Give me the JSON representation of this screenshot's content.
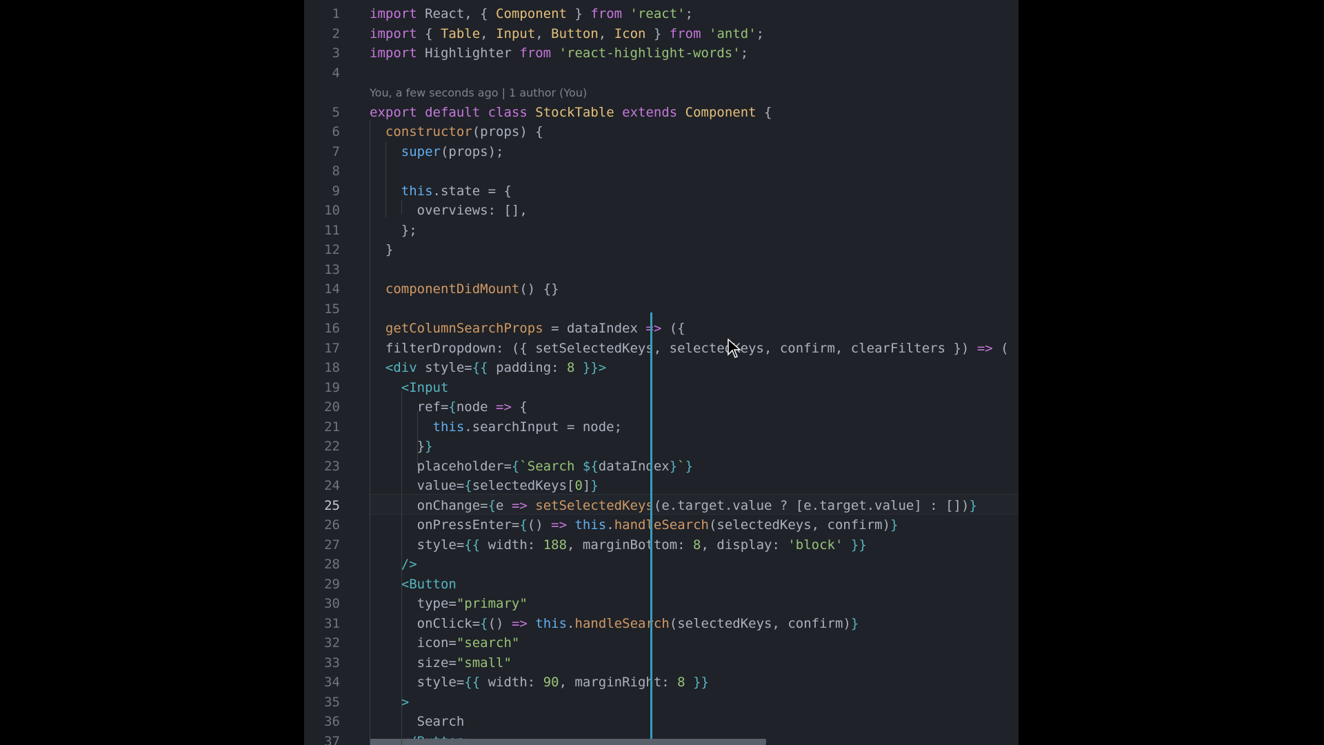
{
  "editor": {
    "codelens": "You, a few seconds ago | 1 author (You)",
    "active_line": "25",
    "lines": [
      {
        "n": "1",
        "tokens": [
          [
            "kw",
            "import"
          ],
          [
            "txt",
            " React, { "
          ],
          [
            "cls",
            "Component"
          ],
          [
            "txt",
            " } "
          ],
          [
            "kw",
            "from"
          ],
          [
            "txt",
            " "
          ],
          [
            "str",
            "'react'"
          ],
          [
            "txt",
            ";"
          ]
        ]
      },
      {
        "n": "2",
        "tokens": [
          [
            "kw",
            "import"
          ],
          [
            "txt",
            " { "
          ],
          [
            "cls",
            "Table"
          ],
          [
            "txt",
            ", "
          ],
          [
            "cls",
            "Input"
          ],
          [
            "txt",
            ", "
          ],
          [
            "cls",
            "Button"
          ],
          [
            "txt",
            ", "
          ],
          [
            "cls",
            "Icon"
          ],
          [
            "txt",
            " } "
          ],
          [
            "kw",
            "from"
          ],
          [
            "txt",
            " "
          ],
          [
            "str",
            "'antd'"
          ],
          [
            "txt",
            ";"
          ]
        ]
      },
      {
        "n": "3",
        "tokens": [
          [
            "kw",
            "import"
          ],
          [
            "txt",
            " Highlighter "
          ],
          [
            "kw",
            "from"
          ],
          [
            "txt",
            " "
          ],
          [
            "str",
            "'react-highlight-words'"
          ],
          [
            "txt",
            ";"
          ]
        ]
      },
      {
        "n": "4",
        "tokens": []
      },
      {
        "n": "5",
        "tokens": [
          [
            "kw",
            "export"
          ],
          [
            "txt",
            " "
          ],
          [
            "kw",
            "default"
          ],
          [
            "txt",
            " "
          ],
          [
            "kw",
            "class"
          ],
          [
            "txt",
            " "
          ],
          [
            "cls",
            "StockTable"
          ],
          [
            "txt",
            " "
          ],
          [
            "kw",
            "extends"
          ],
          [
            "txt",
            " "
          ],
          [
            "cls",
            "Component"
          ],
          [
            "txt",
            " {"
          ]
        ]
      },
      {
        "n": "6",
        "tokens": [
          [
            "txt",
            "  "
          ],
          [
            "fn",
            "constructor"
          ],
          [
            "txt",
            "(props) {"
          ]
        ]
      },
      {
        "n": "7",
        "tokens": [
          [
            "txt",
            "    "
          ],
          [
            "this",
            "super"
          ],
          [
            "txt",
            "(props);"
          ]
        ]
      },
      {
        "n": "8",
        "tokens": []
      },
      {
        "n": "9",
        "tokens": [
          [
            "txt",
            "    "
          ],
          [
            "this",
            "this"
          ],
          [
            "txt",
            ".state = {"
          ]
        ]
      },
      {
        "n": "10",
        "tokens": [
          [
            "txt",
            "      overviews: [],"
          ]
        ]
      },
      {
        "n": "11",
        "tokens": [
          [
            "txt",
            "    };"
          ]
        ]
      },
      {
        "n": "12",
        "tokens": [
          [
            "txt",
            "  }"
          ]
        ]
      },
      {
        "n": "13",
        "tokens": []
      },
      {
        "n": "14",
        "tokens": [
          [
            "txt",
            "  "
          ],
          [
            "fn",
            "componentDidMount"
          ],
          [
            "txt",
            "() {}"
          ]
        ]
      },
      {
        "n": "15",
        "tokens": []
      },
      {
        "n": "16",
        "tokens": [
          [
            "txt",
            "  "
          ],
          [
            "fn",
            "getColumnSearchProps"
          ],
          [
            "txt",
            " = dataIndex "
          ],
          [
            "kw",
            "=>"
          ],
          [
            "txt",
            " ({"
          ]
        ]
      },
      {
        "n": "17",
        "tokens": [
          [
            "txt",
            "  filterDropdown: ({ setSelectedKeys, selectedKeys, confirm, clearFilters }) "
          ],
          [
            "kw",
            "=>"
          ],
          [
            "txt",
            " ("
          ]
        ]
      },
      {
        "n": "18",
        "tokens": [
          [
            "txt",
            "  "
          ],
          [
            "tag",
            "<div"
          ],
          [
            "txt",
            " style="
          ],
          [
            "tag",
            "{{"
          ],
          [
            "txt",
            " padding: "
          ],
          [
            "num",
            "8"
          ],
          [
            "txt",
            " "
          ],
          [
            "tag",
            "}}>"
          ]
        ]
      },
      {
        "n": "19",
        "tokens": [
          [
            "txt",
            "    "
          ],
          [
            "tag",
            "<Input"
          ]
        ]
      },
      {
        "n": "20",
        "tokens": [
          [
            "txt",
            "      ref="
          ],
          [
            "tag",
            "{"
          ],
          [
            "txt",
            "node "
          ],
          [
            "kw",
            "=>"
          ],
          [
            "txt",
            " {"
          ]
        ]
      },
      {
        "n": "21",
        "tokens": [
          [
            "txt",
            "        "
          ],
          [
            "this",
            "this"
          ],
          [
            "txt",
            ".searchInput = node;"
          ]
        ]
      },
      {
        "n": "22",
        "tokens": [
          [
            "txt",
            "      }"
          ],
          [
            "tag",
            "}"
          ]
        ]
      },
      {
        "n": "23",
        "tokens": [
          [
            "txt",
            "      placeholder="
          ],
          [
            "tag",
            "{"
          ],
          [
            "str",
            "`Search "
          ],
          [
            "tag",
            "${"
          ],
          [
            "txt",
            "dataIndex"
          ],
          [
            "tag",
            "}"
          ],
          [
            "str",
            "`"
          ],
          [
            "tag",
            "}"
          ]
        ]
      },
      {
        "n": "24",
        "tokens": [
          [
            "txt",
            "      value="
          ],
          [
            "tag",
            "{"
          ],
          [
            "txt",
            "selectedKeys["
          ],
          [
            "num",
            "0"
          ],
          [
            "txt",
            "]"
          ],
          [
            "tag",
            "}"
          ]
        ]
      },
      {
        "n": "25",
        "tokens": [
          [
            "txt",
            "      onChange="
          ],
          [
            "tag",
            "{"
          ],
          [
            "txt",
            "e "
          ],
          [
            "kw",
            "=>"
          ],
          [
            "txt",
            " "
          ],
          [
            "fn",
            "setSelectedKeys"
          ],
          [
            "txt",
            "(e.target.value ? [e.target.value] : [])"
          ],
          [
            "tag",
            "}"
          ]
        ]
      },
      {
        "n": "26",
        "tokens": [
          [
            "txt",
            "      onPressEnter="
          ],
          [
            "tag",
            "{"
          ],
          [
            "txt",
            "() "
          ],
          [
            "kw",
            "=>"
          ],
          [
            "txt",
            " "
          ],
          [
            "this",
            "this"
          ],
          [
            "txt",
            "."
          ],
          [
            "fn",
            "handleSearch"
          ],
          [
            "txt",
            "(selectedKeys, confirm)"
          ],
          [
            "tag",
            "}"
          ]
        ]
      },
      {
        "n": "27",
        "tokens": [
          [
            "txt",
            "      style="
          ],
          [
            "tag",
            "{{"
          ],
          [
            "txt",
            " width: "
          ],
          [
            "num",
            "188"
          ],
          [
            "txt",
            ", marginBottom: "
          ],
          [
            "num",
            "8"
          ],
          [
            "txt",
            ", display: "
          ],
          [
            "str",
            "'block'"
          ],
          [
            "txt",
            " "
          ],
          [
            "tag",
            "}}"
          ]
        ]
      },
      {
        "n": "28",
        "tokens": [
          [
            "txt",
            "    "
          ],
          [
            "tag",
            "/>"
          ]
        ]
      },
      {
        "n": "29",
        "tokens": [
          [
            "txt",
            "    "
          ],
          [
            "tag",
            "<Button"
          ]
        ]
      },
      {
        "n": "30",
        "tokens": [
          [
            "txt",
            "      type="
          ],
          [
            "str",
            "\"primary\""
          ]
        ]
      },
      {
        "n": "31",
        "tokens": [
          [
            "txt",
            "      onClick="
          ],
          [
            "tag",
            "{"
          ],
          [
            "txt",
            "() "
          ],
          [
            "kw",
            "=>"
          ],
          [
            "txt",
            " "
          ],
          [
            "this",
            "this"
          ],
          [
            "txt",
            "."
          ],
          [
            "fn",
            "handleSearch"
          ],
          [
            "txt",
            "(selectedKeys, confirm)"
          ],
          [
            "tag",
            "}"
          ]
        ]
      },
      {
        "n": "32",
        "tokens": [
          [
            "txt",
            "      icon="
          ],
          [
            "str",
            "\"search\""
          ]
        ]
      },
      {
        "n": "33",
        "tokens": [
          [
            "txt",
            "      size="
          ],
          [
            "str",
            "\"small\""
          ]
        ]
      },
      {
        "n": "34",
        "tokens": [
          [
            "txt",
            "      style="
          ],
          [
            "tag",
            "{{"
          ],
          [
            "txt",
            " width: "
          ],
          [
            "num",
            "90"
          ],
          [
            "txt",
            ", marginRight: "
          ],
          [
            "num",
            "8"
          ],
          [
            "txt",
            " "
          ],
          [
            "tag",
            "}}"
          ]
        ]
      },
      {
        "n": "35",
        "tokens": [
          [
            "txt",
            "    "
          ],
          [
            "tag",
            ">"
          ]
        ]
      },
      {
        "n": "36",
        "tokens": [
          [
            "txt",
            "      Search"
          ]
        ]
      },
      {
        "n": "37",
        "tokens": [
          [
            "txt",
            "    "
          ],
          [
            "tag",
            "</Button>"
          ]
        ]
      }
    ]
  }
}
